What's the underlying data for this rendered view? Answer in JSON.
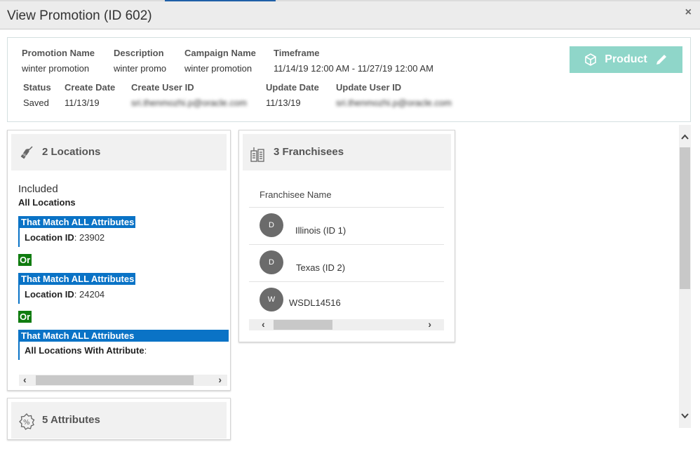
{
  "dialog": {
    "title": "View Promotion (ID 602)",
    "close_icon": "×"
  },
  "summary": {
    "promotion_name": {
      "label": "Promotion Name",
      "value": "winter promotion"
    },
    "description": {
      "label": "Description",
      "value": "winter promo"
    },
    "campaign_name": {
      "label": "Campaign Name",
      "value": "winter promotion"
    },
    "timeframe": {
      "label": "Timeframe",
      "value": "11/14/19 12:00 AM - 11/27/19 12:00 AM"
    },
    "status": {
      "label": "Status",
      "value": "Saved"
    },
    "create_date": {
      "label": "Create Date",
      "value": "11/13/19"
    },
    "create_user_id": {
      "label": "Create User ID",
      "value": "sri.thenmozhi.p@oracle.com"
    },
    "update_date": {
      "label": "Update Date",
      "value": "11/13/19"
    },
    "update_user_id": {
      "label": "Update User ID",
      "value": "sri.thenmozhi.p@oracle.com"
    },
    "product_button": {
      "label": "Product",
      "icon": "cube-icon",
      "edit_icon": "pencil-icon",
      "color": "#8fd6c9"
    }
  },
  "locations": {
    "title": "2 Locations",
    "icon": "tag-percent-icon",
    "included_label": "Included",
    "all_locations_label": "All Locations",
    "groups": [
      {
        "header": "That Match ALL Attributes",
        "key": "Location ID",
        "value": ": 23902"
      },
      {
        "header": "That Match ALL Attributes",
        "key": "Location ID",
        "value": ": 24204"
      },
      {
        "header": "That Match ALL Attributes",
        "key": "All Locations With Attribute",
        "value": ":"
      }
    ],
    "or_label": "Or",
    "accent_color": "#0a73c6",
    "or_color": "#107c10"
  },
  "franchisees": {
    "title": "3 Franchisees",
    "icon": "buildings-icon",
    "column_header": "Franchisee Name",
    "rows": [
      {
        "initial": "D",
        "name": "Illinois (ID 1)"
      },
      {
        "initial": "D",
        "name": "Texas (ID 2)"
      },
      {
        "initial": "W",
        "name": "WSDL14516"
      }
    ]
  },
  "attributes": {
    "title": "5 Attributes",
    "icon": "percent-badge-icon"
  },
  "scroll": {
    "left_arrow": "‹",
    "right_arrow": "›",
    "up_arrow": "︿",
    "down_arrow": "﹀"
  }
}
